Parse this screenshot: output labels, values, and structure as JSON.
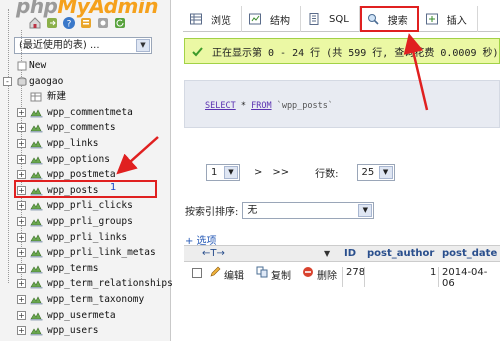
{
  "logo": {
    "part1": "php",
    "part2": "MyAdmin"
  },
  "nav": {
    "recent_select": "(最近使用的表) ...",
    "tree": [
      {
        "label": "New",
        "level": 0,
        "expander": ""
      },
      {
        "label": "gaogao",
        "level": 0,
        "expander": "-"
      },
      {
        "label": "新建",
        "level": 1,
        "expander": ""
      },
      {
        "label": "wpp_commentmeta",
        "level": 1,
        "expander": "+"
      },
      {
        "label": "wpp_comments",
        "level": 1,
        "expander": "+"
      },
      {
        "label": "wpp_links",
        "level": 1,
        "expander": "+"
      },
      {
        "label": "wpp_options",
        "level": 1,
        "expander": "+"
      },
      {
        "label": "wpp_postmeta",
        "level": 1,
        "expander": "+"
      },
      {
        "label": "wpp_posts",
        "level": 1,
        "expander": "+"
      },
      {
        "label": "wpp_prli_clicks",
        "level": 1,
        "expander": "+"
      },
      {
        "label": "wpp_prli_groups",
        "level": 1,
        "expander": "+"
      },
      {
        "label": "wpp_prli_links",
        "level": 1,
        "expander": "+"
      },
      {
        "label": "wpp_prli_link_metas",
        "level": 1,
        "expander": "+"
      },
      {
        "label": "wpp_terms",
        "level": 1,
        "expander": "+"
      },
      {
        "label": "wpp_term_relationships",
        "level": 1,
        "expander": "+"
      },
      {
        "label": "wpp_term_taxonomy",
        "level": 1,
        "expander": "+"
      },
      {
        "label": "wpp_usermeta",
        "level": 1,
        "expander": "+"
      },
      {
        "label": "wpp_users",
        "level": 1,
        "expander": "+"
      }
    ],
    "annotation_1": "1"
  },
  "tabs": {
    "browse": "浏览",
    "structure": "结构",
    "sql": "SQL",
    "search": "搜索",
    "insert": "插入"
  },
  "success_message": "正在显示第 0 - 24 行 (共 599 行, 查询花费 0.0009 秒)",
  "sql": {
    "select": "SELECT",
    "star": "*",
    "from": "FROM",
    "table": "`wpp_posts`"
  },
  "pager": {
    "page": "1",
    "next": ">",
    "last": ">>",
    "rows_label": "行数:",
    "rows": "25"
  },
  "sort": {
    "label": "按索引排序:",
    "value": "无"
  },
  "options_link": "+ 选项",
  "table": {
    "nav_arrows": "←T→",
    "sort_arrow": "▼",
    "headers": [
      "ID",
      "post_author",
      "post_date"
    ],
    "row": {
      "edit": "编辑",
      "copy": "复制",
      "delete": "删除",
      "id": "278",
      "author": "1",
      "date": "2014-04-06"
    }
  },
  "colors": {
    "highlight": "#e02020",
    "success_bg": "#ebf8a4",
    "link": "#2357b5",
    "logo_orange": "#f5a11c"
  }
}
